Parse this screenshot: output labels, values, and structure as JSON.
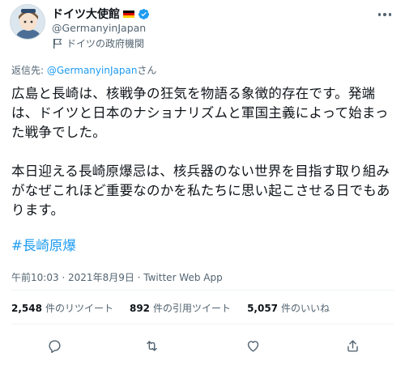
{
  "author": {
    "display_name": "ドイツ大使館",
    "handle": "@GermanyinJapan",
    "label": "ドイツの政府機関"
  },
  "reply": {
    "prefix": "返信先: ",
    "mention": "@GermanyinJapan",
    "suffix": "さん"
  },
  "tweet": {
    "paragraph1": "広島と長崎は、核戦争の狂気を物語る象徴的存在です。発端は、ドイツと日本のナショナリズムと軍国主義によって始まった戦争でした。",
    "paragraph2": "本日迎える長崎原爆忌は、核兵器のない世界を目指す取り組みがなぜこれほど重要なのかを私たちに思い起こさせる日でもあります。",
    "hashtag": "#長崎原爆",
    "meta": "午前10:03 · 2021年8月9日 · Twitter Web App"
  },
  "stats": {
    "retweets_count": "2,548",
    "retweets_label": "件のリツイート",
    "quotes_count": "892",
    "quotes_label": "件の引用ツイート",
    "likes_count": "5,057",
    "likes_label": "件のいいね"
  },
  "icons": {
    "verified": "verified-badge-icon",
    "flag": "germany-flag-icon",
    "gov_label": "flag-label-icon",
    "more": "more-dots-icon",
    "reply": "reply-icon",
    "retweet": "retweet-icon",
    "like": "heart-icon",
    "share": "share-icon"
  },
  "colors": {
    "accent": "#1d9bf0",
    "text": "#0f1419",
    "secondary": "#536471",
    "flag_black": "#000000",
    "flag_red": "#dd0000",
    "flag_gold": "#ffce00"
  }
}
